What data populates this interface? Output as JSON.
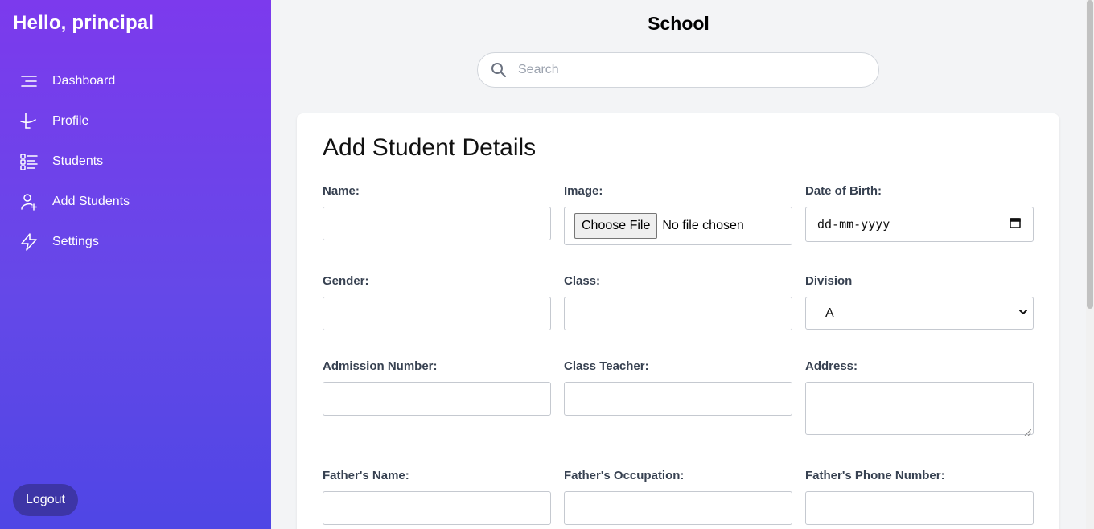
{
  "sidebar": {
    "greeting": "Hello, principal",
    "items": [
      {
        "label": "Dashboard",
        "icon": "menu-lines-icon"
      },
      {
        "label": "Profile",
        "icon": "profile-icon"
      },
      {
        "label": "Students",
        "icon": "list-icon"
      },
      {
        "label": "Add Students",
        "icon": "user-plus-icon"
      },
      {
        "label": "Settings",
        "icon": "bolt-icon"
      }
    ],
    "logout_label": "Logout"
  },
  "header": {
    "title": "School",
    "search_placeholder": "Search",
    "search_value": ""
  },
  "form": {
    "title": "Add Student Details",
    "fields": {
      "name": {
        "label": "Name:",
        "value": ""
      },
      "image": {
        "label": "Image:",
        "button_label": "Choose File",
        "status": "No file chosen"
      },
      "dob": {
        "label": "Date of Birth:",
        "placeholder": "dd-mm-yyyy"
      },
      "gender": {
        "label": "Gender:",
        "value": ""
      },
      "class": {
        "label": "Class:",
        "value": ""
      },
      "division": {
        "label": "Division",
        "selected": "A"
      },
      "admission_number": {
        "label": "Admission Number:",
        "value": ""
      },
      "class_teacher": {
        "label": "Class Teacher:",
        "value": ""
      },
      "address": {
        "label": "Address:",
        "value": ""
      },
      "father_name": {
        "label": "Father's Name:",
        "value": ""
      },
      "father_occupation": {
        "label": "Father's Occupation:",
        "value": ""
      },
      "father_phone": {
        "label": "Father's Phone Number:",
        "value": ""
      }
    }
  },
  "colors": {
    "sidebar_top": "#7c3aed",
    "sidebar_bottom": "#4f46e5",
    "logout_bg": "#3d35a6",
    "page_bg": "#f3f4f6"
  }
}
